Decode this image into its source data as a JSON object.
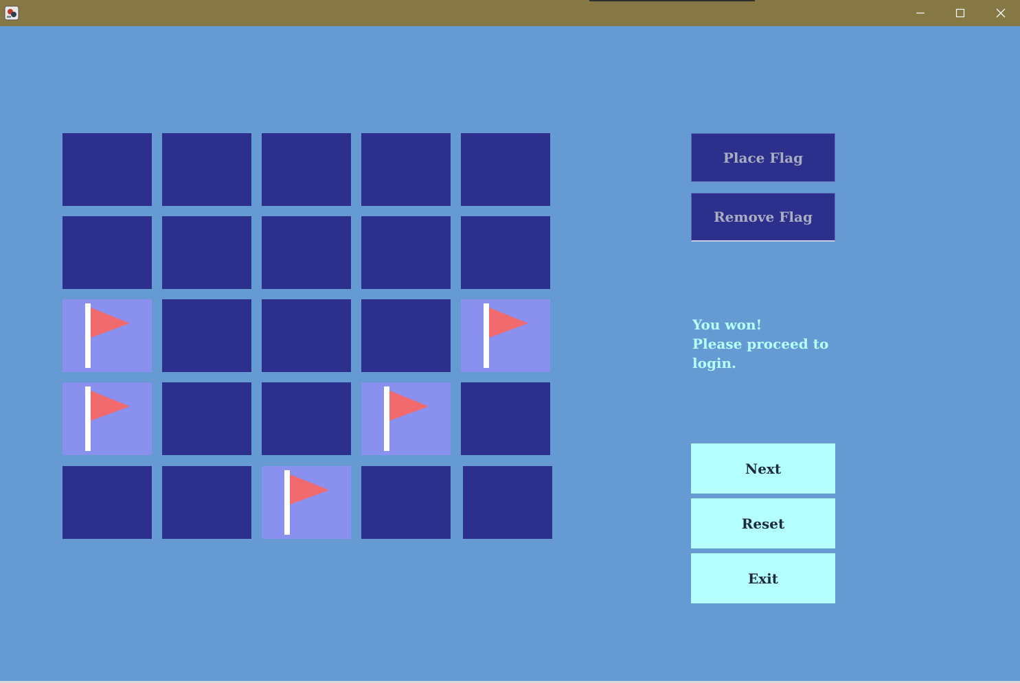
{
  "window": {
    "minimize_icon": "minimize-icon",
    "maximize_icon": "maximize-icon",
    "close_icon": "close-icon",
    "app_icon": "app-icon"
  },
  "board": {
    "rows": 5,
    "cols": 5,
    "cells": [
      [
        "covered",
        "covered",
        "covered",
        "covered",
        "covered"
      ],
      [
        "covered",
        "covered",
        "covered",
        "covered",
        "covered"
      ],
      [
        "flagged",
        "covered",
        "covered",
        "covered",
        "flagged"
      ],
      [
        "flagged",
        "covered",
        "covered",
        "flagged",
        "covered"
      ],
      [
        "covered",
        "covered",
        "flagged",
        "covered",
        "covered"
      ]
    ],
    "colors": {
      "covered": "#2c308c",
      "flagged": "#8990ee",
      "flag_pole": "#ffffff",
      "flag": "#f06a6e"
    }
  },
  "controls": {
    "place_flag_label": "Place Flag",
    "remove_flag_label": "Remove Flag"
  },
  "message": {
    "line1": "You won!",
    "line2": "Please proceed to",
    "line3": "login."
  },
  "actions": {
    "next_label": "Next",
    "reset_label": "Reset",
    "exit_label": "Exit"
  },
  "colors": {
    "background": "#669ad2",
    "titlebar": "#857845",
    "message": "#b4ffff",
    "action_button": "#b4ffff"
  }
}
